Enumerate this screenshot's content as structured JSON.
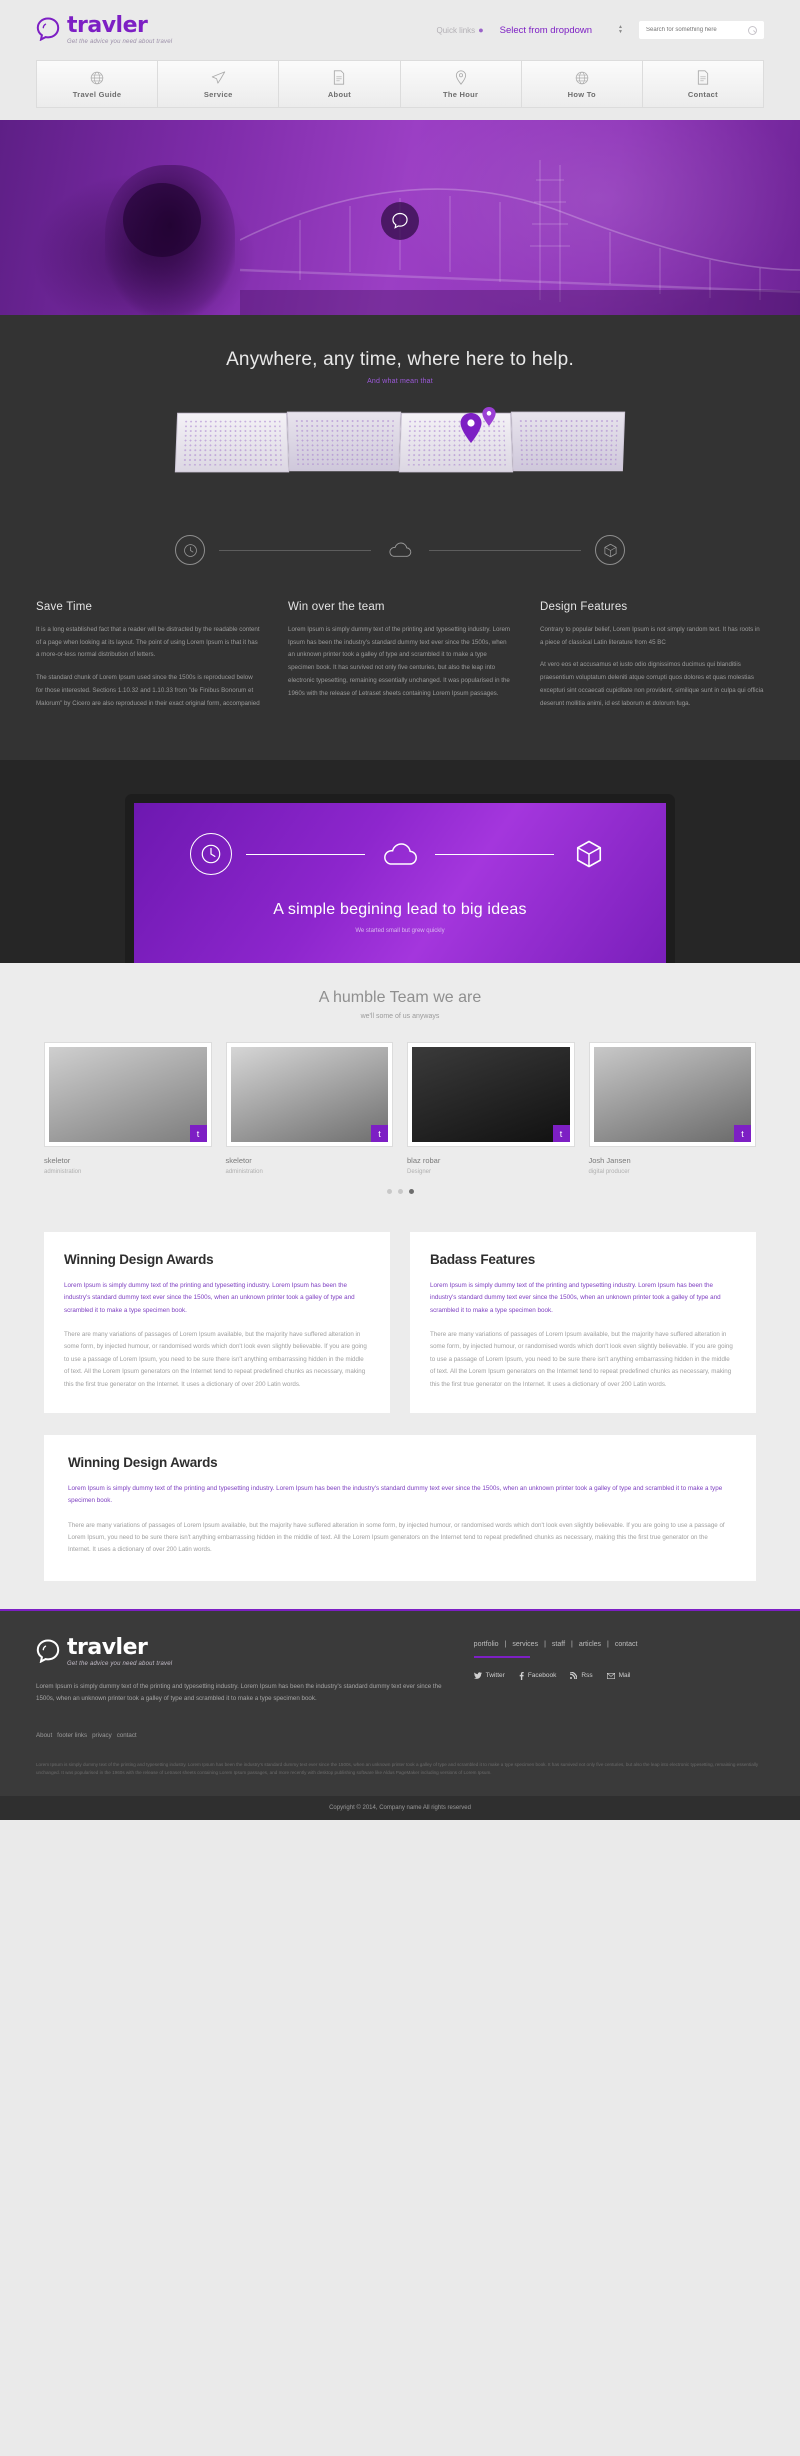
{
  "brand": {
    "name": "travler",
    "tagline": "Get the advice you need about travel"
  },
  "header": {
    "quick_links": "Quick links",
    "quick_links_icon": "location-pin-icon",
    "dropdown_value": "Select from dropdown",
    "search_placeholder": "Search for something here",
    "search_icon": "search-icon"
  },
  "nav": [
    {
      "label": "Travel Guide",
      "icon": "globe-icon"
    },
    {
      "label": "Service",
      "icon": "paper-plane-icon"
    },
    {
      "label": "About",
      "icon": "document-icon"
    },
    {
      "label": "The Hour",
      "icon": "location-pin-icon"
    },
    {
      "label": "How To",
      "icon": "globe-icon"
    },
    {
      "label": "Contact",
      "icon": "document-icon"
    }
  ],
  "hero": {
    "badge_icon": "logo-mark-icon"
  },
  "intro": {
    "title": "Anywhere, any time, where here to help.",
    "subtitle": "And what mean that",
    "step_icons": [
      "clock-icon",
      "cloud-icon",
      "box-icon"
    ],
    "columns": [
      {
        "title": "Save Time",
        "p1": "It is a long established fact that a reader will be distracted by the readable content of a page when looking at its layout. The point of using Lorem Ipsum is that it has a more-or-less normal distribution of letters.",
        "p2": "The standard chunk of Lorem Ipsum used since the 1500s is reproduced below for those interested. Sections 1.10.32 and 1.10.33 from \"de Finibus Bonorum et Malorum\" by Cicero are also reproduced in their exact original form, accompanied"
      },
      {
        "title": "Win over the team",
        "p1": "Lorem Ipsum is simply dummy text of the printing and typesetting industry. Lorem Ipsum has been the industry's standard dummy text ever since the 1500s, when an unknown printer took a galley of type and scrambled it to make a type specimen book. It has survived not only five centuries, but also the leap into electronic typesetting, remaining essentially unchanged. It was popularised in the 1960s with the release of Letraset sheets containing Lorem Ipsum passages.",
        "p2": ""
      },
      {
        "title": "Design Features",
        "p1": "Contrary to popular belief, Lorem Ipsum is not simply random text. It has roots in a piece of classical Latin literature from 45 BC",
        "p2": "At vero eos et accusamus et iusto odio dignissimos ducimus qui blanditiis praesentium voluptatum deleniti atque corrupti quos dolores et quas molestias excepturi sint occaecati cupiditate non provident, similique sunt in culpa qui officia deserunt mollitia animi, id est laborum et dolorum fuga."
      }
    ]
  },
  "showcase": {
    "title": "A simple begining lead to big ideas",
    "subtitle": "We started small but grew quickly",
    "step_icons": [
      "clock-icon",
      "cloud-icon",
      "box-icon"
    ]
  },
  "team": {
    "title": "A humble Team we are",
    "subtitle": "we'll some of us anyways",
    "social_icon": "twitter-icon",
    "members": [
      {
        "name": "skeletor",
        "role": "administration"
      },
      {
        "name": "skeletor",
        "role": "administration"
      },
      {
        "name": "blaz robar",
        "role": "Designer"
      },
      {
        "name": "Josh Jansen",
        "role": "digital producer"
      }
    ],
    "carousel_dots": 3,
    "active_dot": 3
  },
  "panels": [
    {
      "title": "Winning Design Awards",
      "lead": "Lorem Ipsum is simply dummy text of the printing and typesetting industry. Lorem Ipsum has been the industry's standard dummy text ever since the 1500s, when an unknown printer took a galley of type and scrambled it to make a type specimen book.",
      "body": "There are many variations of passages of Lorem Ipsum available, but the majority have suffered alteration in some form, by injected humour, or randomised words which don't look even slightly believable. If you are going to use a passage of Lorem Ipsum, you need to be sure there isn't anything embarrassing hidden in the middle of text. All the Lorem Ipsum generators on the Internet tend to repeat predefined chunks as necessary, making this the first true generator on the Internet. It uses a dictionary of over 200 Latin words."
    },
    {
      "title": "Badass Features",
      "lead": "Lorem Ipsum is simply dummy text of the printing and typesetting industry. Lorem Ipsum has been the industry's standard dummy text ever since the 1500s, when an unknown printer took a galley of type and scrambled it to make a type specimen book.",
      "body": "There are many variations of passages of Lorem Ipsum available, but the majority have suffered alteration in some form, by injected humour, or randomised words which don't look even slightly believable. If you are going to use a passage of Lorem Ipsum, you need to be sure there isn't anything embarrassing hidden in the middle of text. All the Lorem Ipsum generators on the Internet tend to repeat predefined chunks as necessary, making this the first true generator on the Internet. It uses a dictionary of over 200 Latin words."
    }
  ],
  "wide_panel": {
    "title": "Winning Design Awards",
    "lead": "Lorem Ipsum is simply dummy text of the printing and typesetting industry. Lorem Ipsum has been the industry's standard dummy text ever since the 1500s, when an unknown printer took a galley of type and scrambled it to make a type specimen book.",
    "body": "There are many variations of passages of Lorem Ipsum available, but the majority have suffered alteration in some form, by injected humour, or randomised words which don't look even slightly believable. If you are going to use a passage of Lorem Ipsum, you need to be sure there isn't anything embarrassing hidden in the middle of text. All the Lorem Ipsum generators on the Internet tend to repeat predefined chunks as necessary, making this the first true generator on the Internet. It uses a dictionary of over 200 Latin words."
  },
  "footer": {
    "description": "Lorem Ipsum is simply dummy text of the printing and typesetting industry. Lorem Ipsum has been the industry's standard dummy text ever since the 1500s, when an unknown printer took a galley of type and scrambled it to make a type specimen book.",
    "links": [
      "About",
      "footer links",
      "privacy",
      "contact"
    ],
    "nav": [
      "portfolio",
      "services",
      "staff",
      "articles",
      "contact"
    ],
    "social": [
      {
        "label": "Twitter",
        "icon": "twitter-icon"
      },
      {
        "label": "Facebook",
        "icon": "facebook-icon"
      },
      {
        "label": "Rss",
        "icon": "rss-icon"
      },
      {
        "label": "Mail",
        "icon": "mail-icon"
      }
    ],
    "legal": "Lorem Ipsum is simply dummy text of the printing and typesetting industry. Lorem Ipsum has been the industry's standard dummy text ever since the 1500s, when an unknown printer took a galley of type and scrambled it to make a type specimen book. It has survived not only five centuries, but also the leap into electronic typesetting, remaining essentially unchanged. It was popularised in the 1960s with the release of Letraset sheets containing Lorem Ipsum passages, and more recently with desktop publishing software like Aldus PageMaker including versions of Lorem Ipsum.",
    "copyright": "Copyright © 2014, Company name All rights reserved"
  },
  "colors": {
    "brand_purple": "#7d1fc4",
    "accent": "#9b59d8",
    "dark": "#333333",
    "footer": "#3a3a3a"
  }
}
